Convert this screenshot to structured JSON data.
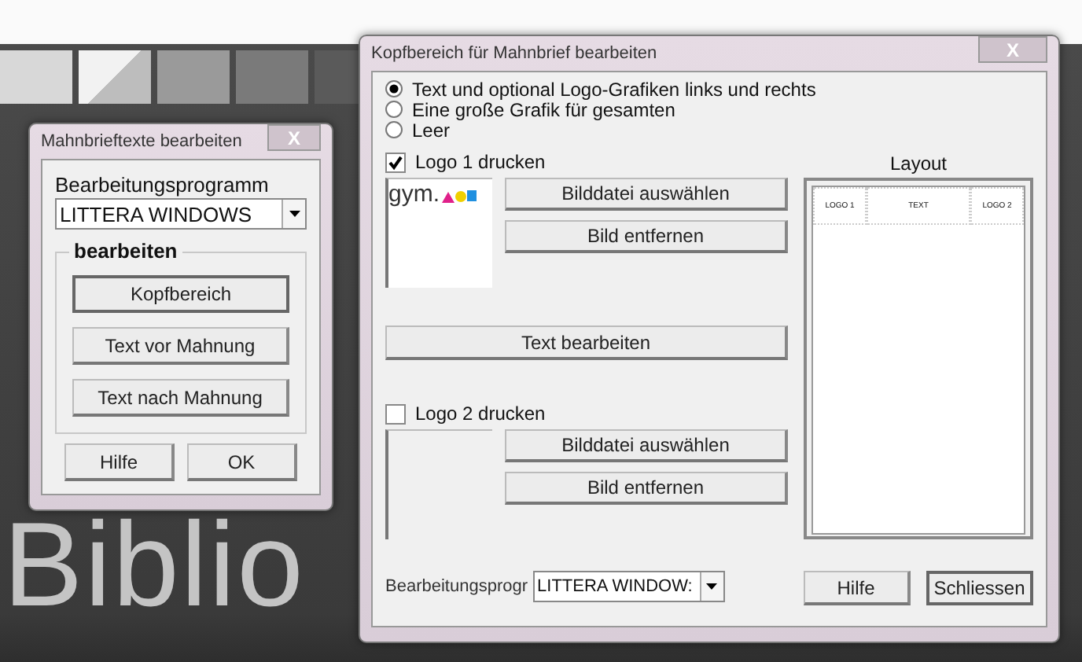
{
  "desktop": {
    "wallpaper_text": "Biblio"
  },
  "left_dialog": {
    "title": "Mahnbrieftexte bearbeiten",
    "close": "X",
    "program_label": "Bearbeitungsprogramm",
    "program_value": "LITTERA WINDOWS",
    "group_label": "bearbeiten",
    "edit_buttons": [
      "Kopfbereich",
      "Text vor Mahnung",
      "Text nach Mahnung"
    ],
    "footer_buttons": [
      "Hilfe",
      "OK"
    ]
  },
  "right_dialog": {
    "title": "Kopfbereich für Mahnbrief bearbeiten",
    "close": "X",
    "options": [
      {
        "label": "Text und optional Logo-Grafiken links und rechts",
        "selected": true
      },
      {
        "label": "Eine große Grafik für gesamten",
        "selected": false
      },
      {
        "label": "Leer",
        "selected": false
      }
    ],
    "logos": [
      {
        "label": "Logo 1 drucken",
        "checked": true,
        "preview": "gym.",
        "buttons": [
          "Bilddatei auswählen",
          "Bild entfernen"
        ]
      },
      {
        "label": "Logo 2 drucken",
        "checked": false,
        "buttons": [
          "Bilddatei auswählen",
          "Bild entfernen"
        ]
      }
    ],
    "text_button": "Text bearbeiten",
    "layout": {
      "title": "Layout",
      "cells": [
        "LOGO 1",
        "TEXT",
        "LOGO 2"
      ]
    },
    "program_label": "Bearbeitungsprogr",
    "program_value": "LITTERA WINDOW:",
    "footer_buttons": [
      "Hilfe",
      "Schliessen"
    ]
  }
}
